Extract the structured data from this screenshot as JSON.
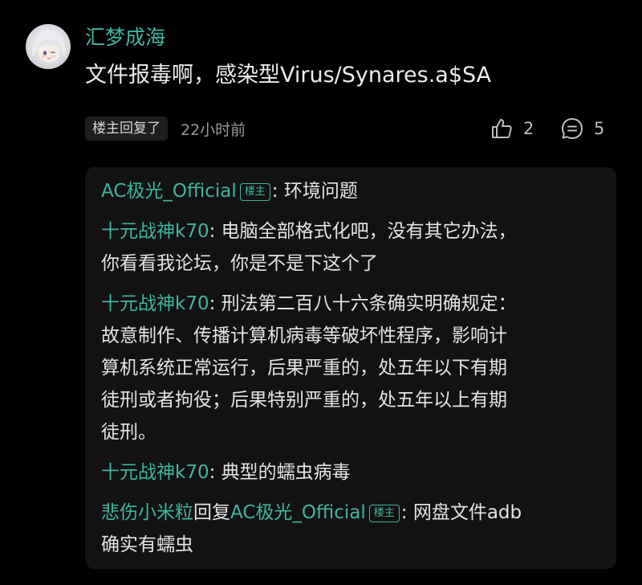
{
  "comment": {
    "username": "汇梦成海",
    "text": "文件报毒啊，感染型Virus/Synares.a$SA",
    "op_replied_badge": "楼主回复了",
    "time": "22小时前",
    "like_count": "2",
    "reply_count": "5",
    "avatar_icon": "anime-avatar"
  },
  "colors": {
    "background": "#000000",
    "accent": "#3fb69e",
    "reply_panel": "#121212",
    "text": "#ececec"
  },
  "replies": [
    {
      "name": "AC极光_Official",
      "tag": "楼主",
      "sep": ": ",
      "lines": [
        "环境问题"
      ]
    },
    {
      "name": "十元战神k70",
      "sep": ": ",
      "lines": [
        "电脑全部格式化吧，没有其它办法，",
        "你看看我论坛，你是不是下这个了"
      ]
    },
    {
      "name": "十元战神k70",
      "sep": ": ",
      "lines": [
        "刑法第二百八十六条确实明确规定：",
        "故意制作、传播计算机病毒等破坏性程序，影响计",
        "算机系统正常运行，后果严重的，处五年以下有期",
        "徒刑或者拘役；后果特别严重的，处五年以上有期",
        "徒刑。"
      ]
    },
    {
      "name": "十元战神k70",
      "sep": ": ",
      "lines": [
        "典型的蠕虫病毒"
      ]
    },
    {
      "name": "悲伤小米粒",
      "reply_word": "回复",
      "target": "AC极光_Official",
      "tag": "楼主",
      "sep": ": ",
      "lines": [
        "网盘文件adb",
        "确实有蠕虫"
      ]
    }
  ]
}
